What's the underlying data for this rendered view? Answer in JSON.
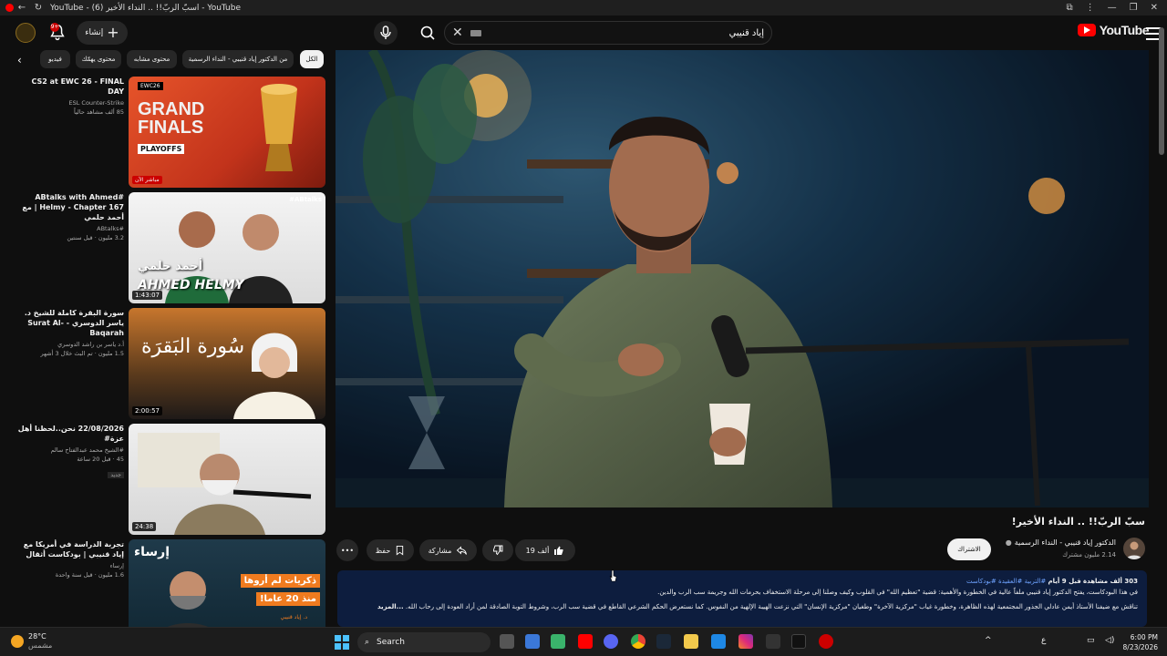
{
  "window": {
    "title": "YouTube - اسبّ الربّ!! .. النداء الأخير (6) - YouTube"
  },
  "header": {
    "logo_text": "YouTube",
    "search_query": "إياد قنيبي",
    "create_label": "إنشاء",
    "notification_count": "9+"
  },
  "chips": [
    {
      "label": "الكل",
      "selected": true
    },
    {
      "label": "من الدكتور إياد قنيبي - النداء الرسمية"
    },
    {
      "label": "محتوى مشابه"
    },
    {
      "label": "محتوى يهمّك"
    },
    {
      "label": "فيديو"
    }
  ],
  "video": {
    "title": "سبّ الربّ!! .. النداء الأخير!",
    "channel": "الدكتور إياد قنيبي - النداء الرسمية",
    "subscribers": "2.14 مليون مشترك",
    "subscribe_label": "الاشتراك",
    "likes": "19 ألف",
    "share_label": "مشاركة",
    "save_label": "حفظ",
    "description": {
      "views": "303 ألف مشاهدة",
      "age": "قبل 9 أيام",
      "tags": "#التربية #العقيدة #بودكاست",
      "line1": "في هذا البودكاست، يفتح الدكتور إياد قنيبي ملفاً عالية في الخطورة والأهمية: قضية \"تعظيم الله\" في القلوب وكيف وصلنا إلى مرحلة الاستخفاف بحرمات الله وجريمة سب الرب والدين.",
      "line2": "تناقش مع ضيفنا الأستاذ أيمن عادلي الجذور المجتمعية لهذه الظاهرة، وخطورة غياب \"مركزية الآخرة\" وطغيان \"مركزية الإنسان\" التي نزعت الهيبة الإلهية من النفوس. كما نستعرض الحكم الشرعي القاطع في قضية سب الرب، وشروط التوبة الصادقة لمن أراد العودة إلى رحاب الله.",
      "more": "...المزيد"
    }
  },
  "sidebar": [
    {
      "title": "CS2 at EWC 26 - FINAL DAY",
      "channel": "ESL Counter-Strike",
      "stats": "85 ألف مشاهد حالياً",
      "live_label": "مباشر الآن",
      "thumb_text1": "GRAND",
      "thumb_text2": "FINALS",
      "thumb_text3": "PLAYOFFS",
      "thumb_brand": "EWC26"
    },
    {
      "title": "#ABtalks with Ahmed Helmy - Chapter 167 | مع أحمد حلمي",
      "channel": "#ABtalks",
      "stats": "3.2 مليون · قبل سنتين",
      "duration": "1:43:07",
      "thumb_text1": "أحمد حلمي",
      "thumb_text2": "AHMED HELMY",
      "thumb_brand": "#ABtalks"
    },
    {
      "title": "سورة البقرة كاملة للشيخ د. ياسر الدوسري - Surat Al-Baqarah",
      "channel": "أ.د ياسر بن راشد الدوسري",
      "stats": "1.5 مليون · تم البث خلال 3 أشهر",
      "duration": "2:00:57",
      "thumb_text1": "سُورة البَقرَة"
    },
    {
      "title": "22/08/2026 نحن..لحظنا أهل عزة#",
      "channel": "#الشيخ محمد عبدالفتاح سالم",
      "stats": "45 · قبل 20 ساعة",
      "tag": "جديد",
      "duration": "24:38"
    },
    {
      "title": "تجربة الدراسة في أمريكا مع إياد قنيبي | بودكاست أثقال",
      "channel": "إرساء",
      "stats": "1.6 مليون · قبل سنة واحدة",
      "thumb_text1": "إرساء",
      "thumb_text2": "ذكريات لم أروها",
      "thumb_text3": "منذ 20 عاما!",
      "thumb_brand": "د. إياد قنيبي"
    }
  ],
  "taskbar": {
    "temperature": "28°C",
    "weather": "مشمس",
    "search_label": "Search",
    "time": "6:00 PM",
    "date": "8/23/2026",
    "lang": "ع"
  },
  "colors": {
    "youtube_red": "#ff0000",
    "background": "#0f0f0f",
    "description_bg": "#0d1d3e",
    "link": "#6fa3ff"
  }
}
